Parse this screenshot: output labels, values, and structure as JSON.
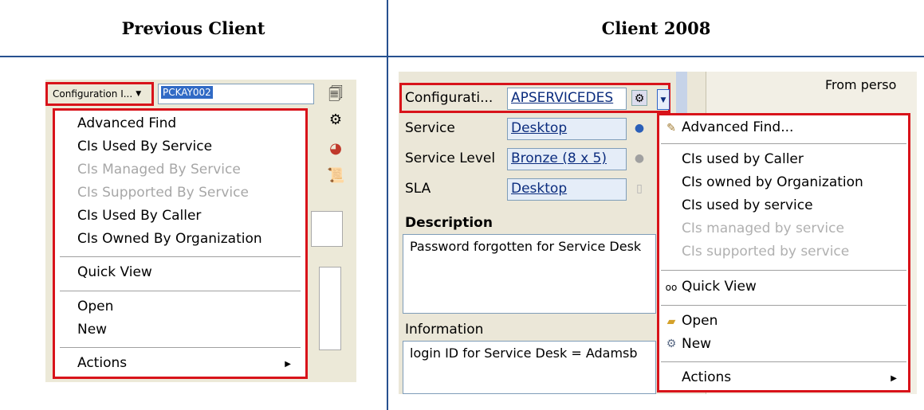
{
  "headers": {
    "left": "Previous Client",
    "right": "Client 2008"
  },
  "left": {
    "dropdown_label": "Configuration I...",
    "input_value": "PCKAY002",
    "menu": [
      "Advanced Find",
      "CIs Used By Service",
      "CIs Managed By Service",
      "CIs Supported By Service",
      "CIs Used By Caller",
      "CIs Owned By Organization",
      "Quick View",
      "Open",
      "New",
      "Actions"
    ],
    "disabled_items": [
      "CIs Managed By Service",
      "CIs Supported By Service"
    ]
  },
  "right": {
    "from_text": "From perso",
    "fields": [
      {
        "label": "Configurati...",
        "value": "APSERVICEDES"
      },
      {
        "label": "Service",
        "value": "Desktop"
      },
      {
        "label": "Service Level",
        "value": "Bronze (8 x 5)"
      },
      {
        "label": "SLA",
        "value": "Desktop"
      }
    ],
    "description_heading": "Description",
    "description_text": "Password forgotten for Service Desk",
    "information_heading": "Information",
    "information_text": "login ID for Service Desk = Adamsb",
    "menu": [
      "Advanced Find...",
      "CIs used by Caller",
      "CIs owned by Organization",
      "CIs used by service",
      "CIs managed by service",
      "CIs supported by service",
      "Quick View",
      "Open",
      "New",
      "Actions"
    ],
    "disabled_items": [
      "CIs managed by service",
      "CIs supported by service"
    ]
  },
  "colors": {
    "highlight_border": "#d8131a",
    "divider": "#26508f",
    "link": "#0b2c7e"
  },
  "icons": [
    "dropdown-caret-icon",
    "submenu-arrow-icon",
    "pencil-icon",
    "glasses-icon",
    "folder-open-icon",
    "new-ci-icon"
  ]
}
